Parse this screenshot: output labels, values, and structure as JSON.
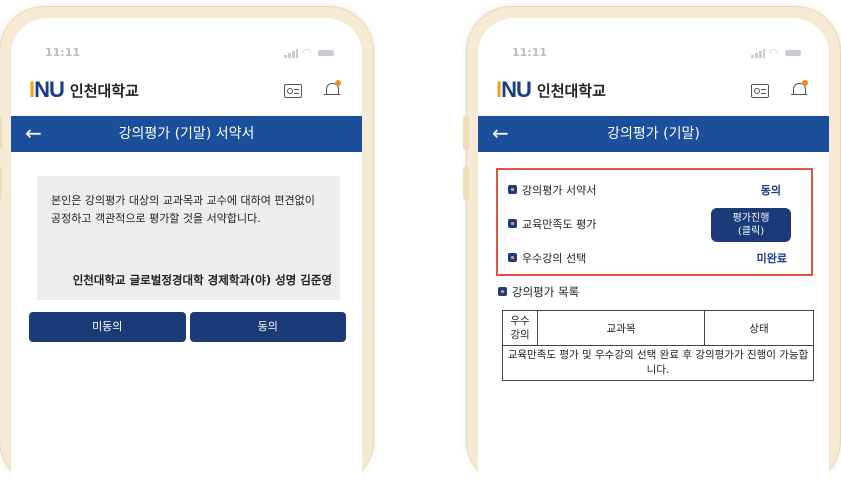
{
  "colors": {
    "primary": "#1b4f9c",
    "button": "#1a3a78",
    "accent": "#f1a21b",
    "highlight": "#e0553c",
    "frame": "#f6ead4"
  },
  "left": {
    "status_time": "11:11",
    "logo_mark": "INU",
    "logo_name": "인천대학교",
    "header_icons": [
      "id-card-icon",
      "bell-icon"
    ],
    "title": "강의평가 (기말) 서약서",
    "pledge_text": "본인은 강의평가 대상의 교과목과 교수에 대하여 편견없이 공정하고 객관적으로 평가할 것을 서약합니다.",
    "signature": "인천대학교 글로벌정경대학 경제학과(야) 성명 김준영",
    "buttons": {
      "disagree": "미동의",
      "agree": "동의"
    }
  },
  "right": {
    "status_time": "11:11",
    "logo_mark": "INU",
    "logo_name": "인천대학교",
    "title": "강의평가 (기말)",
    "steps": [
      {
        "label": "강의평가 서약서",
        "value": "동의"
      },
      {
        "label": "교육만족도 평가",
        "value": "평가진행\n(클릭)"
      },
      {
        "label": "우수강의 선택",
        "value": "미완료"
      }
    ],
    "list_title": "강의평가 목록",
    "table": {
      "headers": [
        "우수\n강의",
        "교과목",
        "상태"
      ],
      "message": "교육만족도 평가 및 우수강의 선택 완료 후 강의평가가 진행이 가능합니다."
    }
  }
}
